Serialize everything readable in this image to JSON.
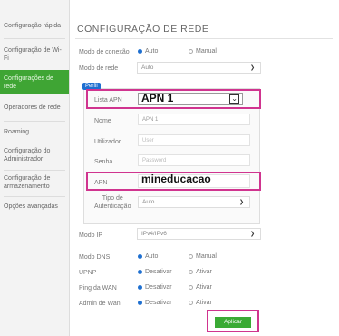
{
  "sidebar": {
    "items": [
      {
        "label": "Configuração rápida"
      },
      {
        "label": "Configuração de Wi-Fi"
      },
      {
        "label": "Configurações de rede"
      },
      {
        "label": "Operadores de rede"
      },
      {
        "label": "Roaming"
      },
      {
        "label": "Configuração do Administrador"
      },
      {
        "label": "Configuração de armazenamento"
      },
      {
        "label": "Opções avançadas"
      }
    ]
  },
  "page": {
    "title": "CONFIGURAÇÃO DE REDE"
  },
  "connection_mode": {
    "label": "Modo de conexão",
    "option_auto": "Auto",
    "option_manual": "Manual"
  },
  "network_mode": {
    "label": "Modo de rede",
    "value": "Auto"
  },
  "profile": {
    "badge": "Perfil",
    "apn_list": {
      "label": "Lista APN",
      "value": "APN 1"
    },
    "name": {
      "label": "Nome",
      "value": "APN 1"
    },
    "user": {
      "label": "Utilizador",
      "placeholder": "User"
    },
    "password": {
      "label": "Senha",
      "placeholder": "Password"
    },
    "apn": {
      "label": "APN",
      "value": "mineducacao"
    },
    "auth_type": {
      "label_line1": "Tipo de",
      "label_line2": "Autenticação",
      "value": "Auto"
    }
  },
  "ip_mode": {
    "label": "Modo IP",
    "value": "IPv4/IPv6"
  },
  "dns_mode": {
    "label": "Modo DNS",
    "option_auto": "Auto",
    "option_manual": "Manual"
  },
  "upnp": {
    "label": "UPNP",
    "option_off": "Desativar",
    "option_on": "Ativar"
  },
  "wan_ping": {
    "label": "Ping da WAN",
    "option_off": "Desativar",
    "option_on": "Ativar"
  },
  "wan_admin": {
    "label": "Admin de Wan",
    "option_off": "Desativar",
    "option_on": "Ativar"
  },
  "apply_label": "Aplicar",
  "colors": {
    "accent_green": "#3aaa35",
    "highlight": "#d0348f",
    "radio_blue": "#1e6fd0"
  }
}
